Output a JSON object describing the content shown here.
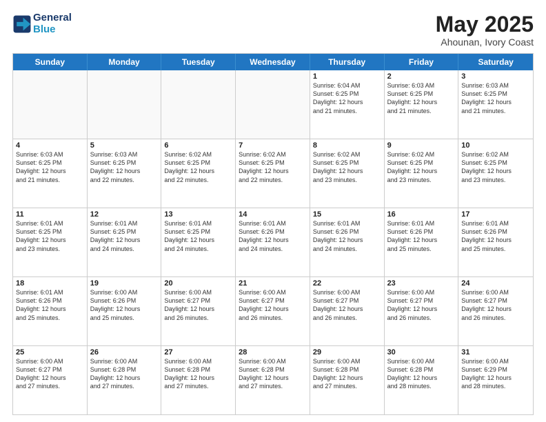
{
  "header": {
    "logo_line1": "General",
    "logo_line2": "Blue",
    "title": "May 2025",
    "subtitle": "Ahounan, Ivory Coast"
  },
  "weekdays": [
    "Sunday",
    "Monday",
    "Tuesday",
    "Wednesday",
    "Thursday",
    "Friday",
    "Saturday"
  ],
  "weeks": [
    [
      {
        "day": "",
        "info": ""
      },
      {
        "day": "",
        "info": ""
      },
      {
        "day": "",
        "info": ""
      },
      {
        "day": "",
        "info": ""
      },
      {
        "day": "1",
        "info": "Sunrise: 6:04 AM\nSunset: 6:25 PM\nDaylight: 12 hours\nand 21 minutes."
      },
      {
        "day": "2",
        "info": "Sunrise: 6:03 AM\nSunset: 6:25 PM\nDaylight: 12 hours\nand 21 minutes."
      },
      {
        "day": "3",
        "info": "Sunrise: 6:03 AM\nSunset: 6:25 PM\nDaylight: 12 hours\nand 21 minutes."
      }
    ],
    [
      {
        "day": "4",
        "info": "Sunrise: 6:03 AM\nSunset: 6:25 PM\nDaylight: 12 hours\nand 21 minutes."
      },
      {
        "day": "5",
        "info": "Sunrise: 6:03 AM\nSunset: 6:25 PM\nDaylight: 12 hours\nand 22 minutes."
      },
      {
        "day": "6",
        "info": "Sunrise: 6:02 AM\nSunset: 6:25 PM\nDaylight: 12 hours\nand 22 minutes."
      },
      {
        "day": "7",
        "info": "Sunrise: 6:02 AM\nSunset: 6:25 PM\nDaylight: 12 hours\nand 22 minutes."
      },
      {
        "day": "8",
        "info": "Sunrise: 6:02 AM\nSunset: 6:25 PM\nDaylight: 12 hours\nand 23 minutes."
      },
      {
        "day": "9",
        "info": "Sunrise: 6:02 AM\nSunset: 6:25 PM\nDaylight: 12 hours\nand 23 minutes."
      },
      {
        "day": "10",
        "info": "Sunrise: 6:02 AM\nSunset: 6:25 PM\nDaylight: 12 hours\nand 23 minutes."
      }
    ],
    [
      {
        "day": "11",
        "info": "Sunrise: 6:01 AM\nSunset: 6:25 PM\nDaylight: 12 hours\nand 23 minutes."
      },
      {
        "day": "12",
        "info": "Sunrise: 6:01 AM\nSunset: 6:25 PM\nDaylight: 12 hours\nand 24 minutes."
      },
      {
        "day": "13",
        "info": "Sunrise: 6:01 AM\nSunset: 6:25 PM\nDaylight: 12 hours\nand 24 minutes."
      },
      {
        "day": "14",
        "info": "Sunrise: 6:01 AM\nSunset: 6:26 PM\nDaylight: 12 hours\nand 24 minutes."
      },
      {
        "day": "15",
        "info": "Sunrise: 6:01 AM\nSunset: 6:26 PM\nDaylight: 12 hours\nand 24 minutes."
      },
      {
        "day": "16",
        "info": "Sunrise: 6:01 AM\nSunset: 6:26 PM\nDaylight: 12 hours\nand 25 minutes."
      },
      {
        "day": "17",
        "info": "Sunrise: 6:01 AM\nSunset: 6:26 PM\nDaylight: 12 hours\nand 25 minutes."
      }
    ],
    [
      {
        "day": "18",
        "info": "Sunrise: 6:01 AM\nSunset: 6:26 PM\nDaylight: 12 hours\nand 25 minutes."
      },
      {
        "day": "19",
        "info": "Sunrise: 6:00 AM\nSunset: 6:26 PM\nDaylight: 12 hours\nand 25 minutes."
      },
      {
        "day": "20",
        "info": "Sunrise: 6:00 AM\nSunset: 6:27 PM\nDaylight: 12 hours\nand 26 minutes."
      },
      {
        "day": "21",
        "info": "Sunrise: 6:00 AM\nSunset: 6:27 PM\nDaylight: 12 hours\nand 26 minutes."
      },
      {
        "day": "22",
        "info": "Sunrise: 6:00 AM\nSunset: 6:27 PM\nDaylight: 12 hours\nand 26 minutes."
      },
      {
        "day": "23",
        "info": "Sunrise: 6:00 AM\nSunset: 6:27 PM\nDaylight: 12 hours\nand 26 minutes."
      },
      {
        "day": "24",
        "info": "Sunrise: 6:00 AM\nSunset: 6:27 PM\nDaylight: 12 hours\nand 26 minutes."
      }
    ],
    [
      {
        "day": "25",
        "info": "Sunrise: 6:00 AM\nSunset: 6:27 PM\nDaylight: 12 hours\nand 27 minutes."
      },
      {
        "day": "26",
        "info": "Sunrise: 6:00 AM\nSunset: 6:28 PM\nDaylight: 12 hours\nand 27 minutes."
      },
      {
        "day": "27",
        "info": "Sunrise: 6:00 AM\nSunset: 6:28 PM\nDaylight: 12 hours\nand 27 minutes."
      },
      {
        "day": "28",
        "info": "Sunrise: 6:00 AM\nSunset: 6:28 PM\nDaylight: 12 hours\nand 27 minutes."
      },
      {
        "day": "29",
        "info": "Sunrise: 6:00 AM\nSunset: 6:28 PM\nDaylight: 12 hours\nand 27 minutes."
      },
      {
        "day": "30",
        "info": "Sunrise: 6:00 AM\nSunset: 6:28 PM\nDaylight: 12 hours\nand 28 minutes."
      },
      {
        "day": "31",
        "info": "Sunrise: 6:00 AM\nSunset: 6:29 PM\nDaylight: 12 hours\nand 28 minutes."
      }
    ]
  ]
}
